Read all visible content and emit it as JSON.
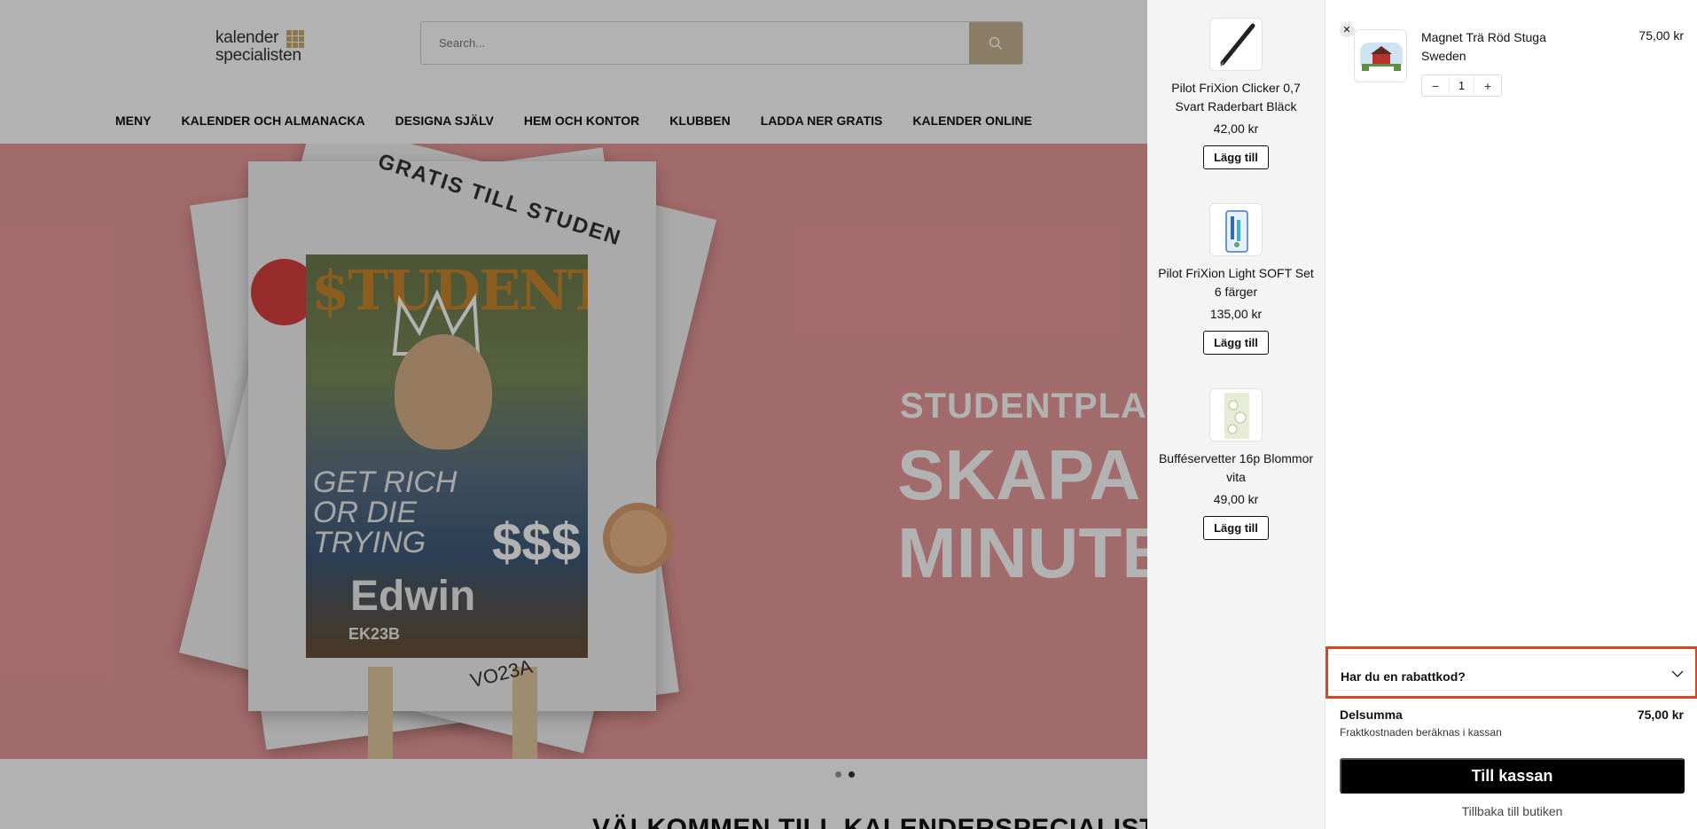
{
  "site": {
    "logo": {
      "line1": "kalender",
      "line2": "specialisten"
    },
    "search": {
      "placeholder": "Search..."
    },
    "nav": [
      "MENY",
      "KALENDER OCH ALMANACKA",
      "DESIGNA SJÄLV",
      "HEM OCH KONTOR",
      "KLUBBEN",
      "LADDA NER GRATIS",
      "KALENDER ONLINE"
    ],
    "hero": {
      "poster_arc": "GRATIS TILL STUDEN",
      "cover_title": "$TUDENT",
      "cover_slogan": "GET RICH OR DIE TRYING",
      "cover_money": "$$$",
      "cover_name": "Edwin",
      "cover_class": "EK23B",
      "poster_bottom": "VO23A",
      "subtitle": "STUDENTPLAK",
      "headline_line1": "SKAPA P",
      "headline_line2": "MINUTER"
    },
    "welcome": "VÄLKOMMEN TILL KALENDERSPECIALISTEN"
  },
  "upsell": [
    {
      "name": "Pilot FriXion Clicker 0,7 Svart Raderbart Bläck",
      "price": "42,00 kr",
      "button": "Lägg till",
      "icon": "pen-icon"
    },
    {
      "name": "Pilot FriXion Light SOFT Set 6 färger",
      "price": "135,00 kr",
      "button": "Lägg till",
      "icon": "highlighter-set-icon"
    },
    {
      "name": "Bufféservetter 16p Blommor vita",
      "price": "49,00 kr",
      "button": "Lägg till",
      "icon": "napkin-icon"
    }
  ],
  "cart": {
    "item": {
      "name": "Magnet Trä Röd Stuga Sweden",
      "price": "75,00 kr",
      "quantity": "1",
      "remove": "✕",
      "minus": "−",
      "plus": "+"
    },
    "discount_label": "Har du en rabattkod?",
    "subtotal_label": "Delsumma",
    "subtotal_value": "75,00 kr",
    "shipping_note": "Fraktkostnaden beräknas i kassan",
    "checkout": "Till kassan",
    "back": "Tillbaka till butiken"
  },
  "colors": {
    "accent_highlight": "#e0441c",
    "hero_bg": "#e99a9a",
    "search_button": "#c9b593",
    "checkout_bg": "#000000"
  }
}
